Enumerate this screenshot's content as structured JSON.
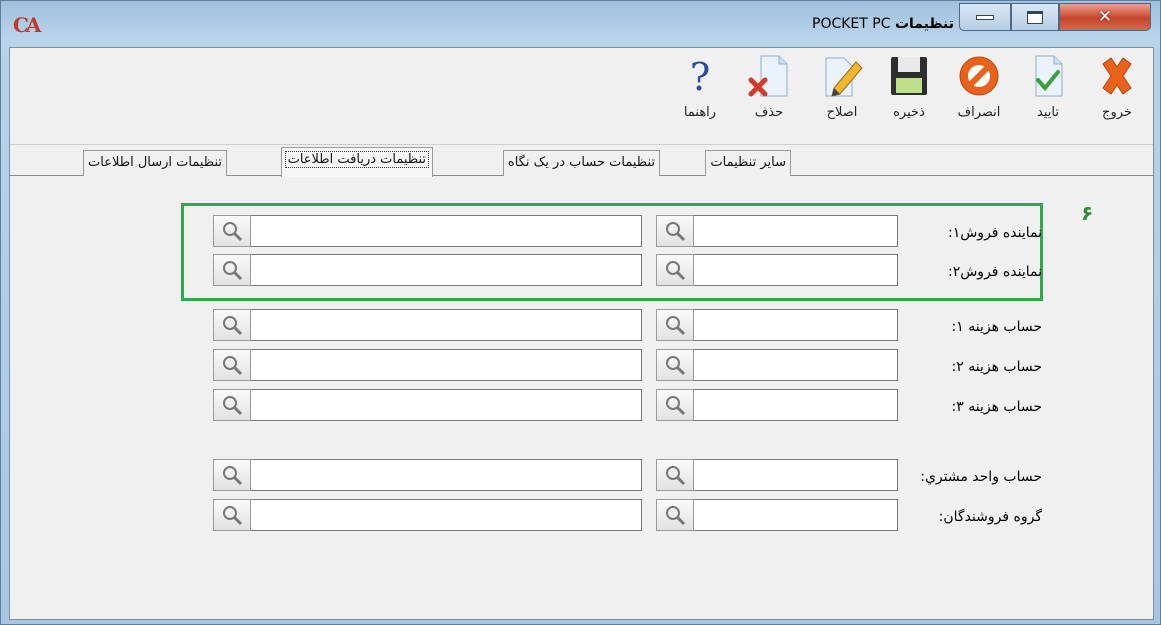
{
  "window": {
    "logo_text": "CA",
    "title_brand": "POCKET PC",
    "title_label": "تنظیمات",
    "controls": {
      "minimize": "minimize",
      "maximize": "maximize",
      "close": "close"
    }
  },
  "toolbar": {
    "buttons": [
      {
        "label": "خروج",
        "icon": "exit-x-icon"
      },
      {
        "label": "تایید",
        "icon": "confirm-check-icon"
      },
      {
        "label": "انصراف",
        "icon": "cancel-prohibit-icon"
      },
      {
        "label": "ذخیره",
        "icon": "save-floppy-icon"
      },
      {
        "label": "اصلاح",
        "icon": "edit-pencil-icon"
      },
      {
        "label": "حذف",
        "icon": "delete-icon"
      },
      {
        "label": "راهنما",
        "icon": "help-icon"
      }
    ]
  },
  "tabs": [
    {
      "label": "سایر تنظیمات",
      "active": false
    },
    {
      "label": "تنظیمات حساب در یک نگاه",
      "active": false
    },
    {
      "label": "تنظیمات دریافت اطلاعات",
      "active": true
    },
    {
      "label": "تنظیمات ارسال اطلاعات",
      "active": false
    }
  ],
  "form": {
    "section_number": "۶",
    "rows": [
      {
        "label": "نماینده فروش۱:",
        "code": "",
        "name": ""
      },
      {
        "label": "نماینده فروش۲:",
        "code": "",
        "name": ""
      },
      {
        "label": "حساب هزینه ۱:",
        "code": "",
        "name": ""
      },
      {
        "label": "حساب هزینه ۲:",
        "code": "",
        "name": ""
      },
      {
        "label": "حساب هزینه ۳:",
        "code": "",
        "name": ""
      },
      {
        "label": "حساب واحد مشتري:",
        "code": "",
        "name": ""
      },
      {
        "label": "گروه فروشندگان:",
        "code": "",
        "name": ""
      }
    ]
  },
  "colors": {
    "highlight_border": "#2eaa4a",
    "close_button": "#c8452c"
  }
}
